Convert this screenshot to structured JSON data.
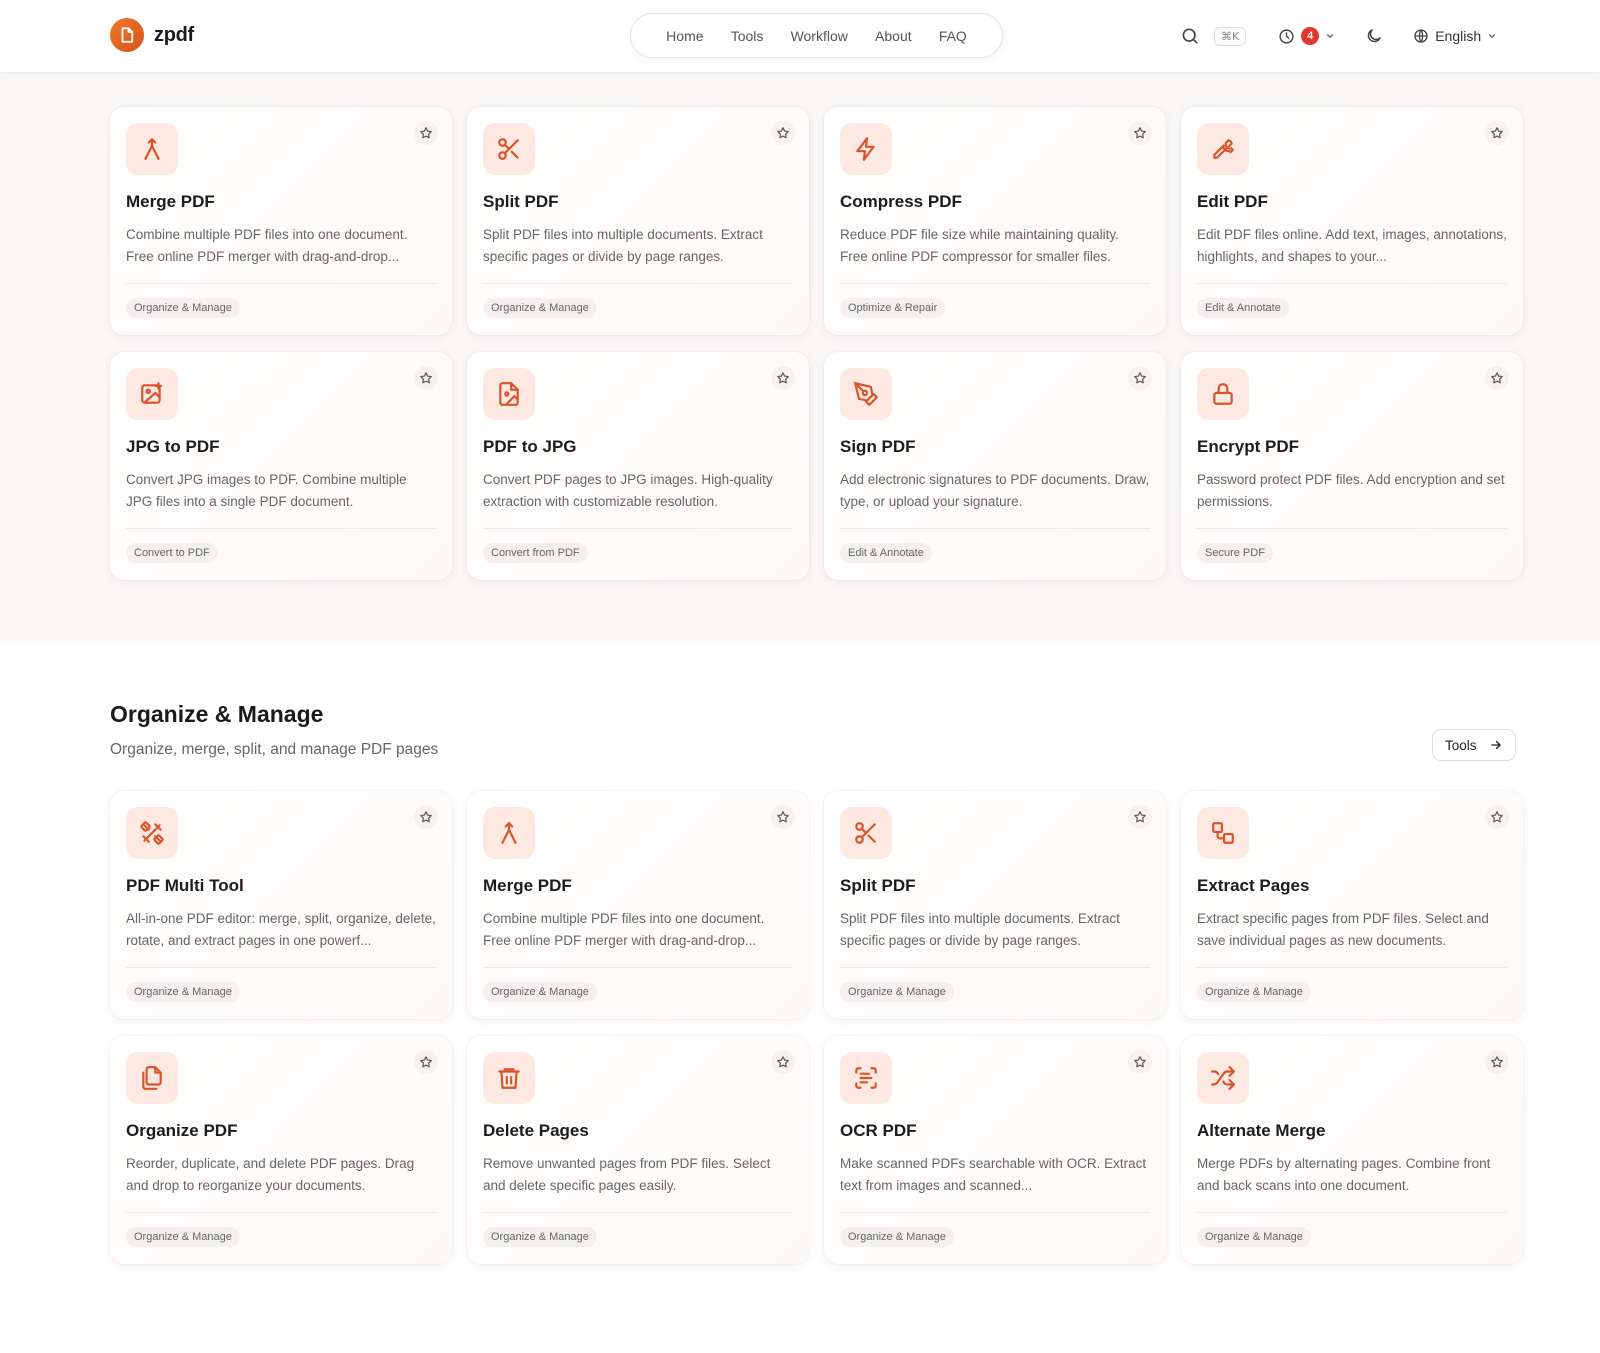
{
  "brand": {
    "name": "zpdf",
    "accent": "#e0582b",
    "icon_bg": "#fde9e1"
  },
  "nav": {
    "items": [
      "Home",
      "Tools",
      "Workflow",
      "About",
      "FAQ"
    ]
  },
  "header": {
    "shortcut": "⌘K",
    "history_count": "4",
    "language": "English"
  },
  "featured": {
    "cards": [
      {
        "icon": "merge-icon",
        "title": "Merge PDF",
        "desc": "Combine multiple PDF files into one document. Free online PDF merger with drag-and-drop...",
        "tag": "Organize & Manage"
      },
      {
        "icon": "scissors-icon",
        "title": "Split PDF",
        "desc": "Split PDF files into multiple documents. Extract specific pages or divide by page ranges.",
        "tag": "Organize & Manage"
      },
      {
        "icon": "lightning-icon",
        "title": "Compress PDF",
        "desc": "Reduce PDF file size while maintaining quality. Free online PDF compressor for smaller files.",
        "tag": "Optimize & Repair"
      },
      {
        "icon": "wrench-icon",
        "title": "Edit PDF",
        "desc": "Edit PDF files online. Add text, images, annotations, highlights, and shapes to your...",
        "tag": "Edit & Annotate"
      },
      {
        "icon": "image-plus-icon",
        "title": "JPG to PDF",
        "desc": "Convert JPG images to PDF. Combine multiple JPG files into a single PDF document.",
        "tag": "Convert to PDF"
      },
      {
        "icon": "file-image-icon",
        "title": "PDF to JPG",
        "desc": "Convert PDF pages to JPG images. High-quality extraction with customizable resolution.",
        "tag": "Convert from PDF"
      },
      {
        "icon": "pen-tool-icon",
        "title": "Sign PDF",
        "desc": "Add electronic signatures to PDF documents. Draw, type, or upload your signature.",
        "tag": "Edit & Annotate"
      },
      {
        "icon": "lock-icon",
        "title": "Encrypt PDF",
        "desc": "Password protect PDF files. Add encryption and set permissions.",
        "tag": "Secure PDF"
      }
    ]
  },
  "organize": {
    "title": "Organize & Manage",
    "subtitle": "Organize, merge, split, and manage PDF pages",
    "button": "Tools",
    "cards": [
      {
        "icon": "multi-tool-icon",
        "title": "PDF Multi Tool",
        "desc": "All-in-one PDF editor: merge, split, organize, delete, rotate, and extract pages in one powerf...",
        "tag": "Organize & Manage"
      },
      {
        "icon": "merge-icon",
        "title": "Merge PDF",
        "desc": "Combine multiple PDF files into one document. Free online PDF merger with drag-and-drop...",
        "tag": "Organize & Manage"
      },
      {
        "icon": "scissors-icon",
        "title": "Split PDF",
        "desc": "Split PDF files into multiple documents. Extract specific pages or divide by page ranges.",
        "tag": "Organize & Manage"
      },
      {
        "icon": "extract-icon",
        "title": "Extract Pages",
        "desc": "Extract specific pages from PDF files. Select and save individual pages as new documents.",
        "tag": "Organize & Manage"
      },
      {
        "icon": "copy-icon",
        "title": "Organize PDF",
        "desc": "Reorder, duplicate, and delete PDF pages. Drag and drop to reorganize your documents.",
        "tag": "Organize & Manage"
      },
      {
        "icon": "trash-icon",
        "title": "Delete Pages",
        "desc": "Remove unwanted pages from PDF files. Select and delete specific pages easily.",
        "tag": "Organize & Manage"
      },
      {
        "icon": "scan-text-icon",
        "title": "OCR PDF",
        "desc": "Make scanned PDFs searchable with OCR. Extract text from images and scanned...",
        "tag": "Organize & Manage"
      },
      {
        "icon": "shuffle-icon",
        "title": "Alternate Merge",
        "desc": "Merge PDFs by alternating pages. Combine front and back scans into one document.",
        "tag": "Organize & Manage"
      }
    ]
  }
}
